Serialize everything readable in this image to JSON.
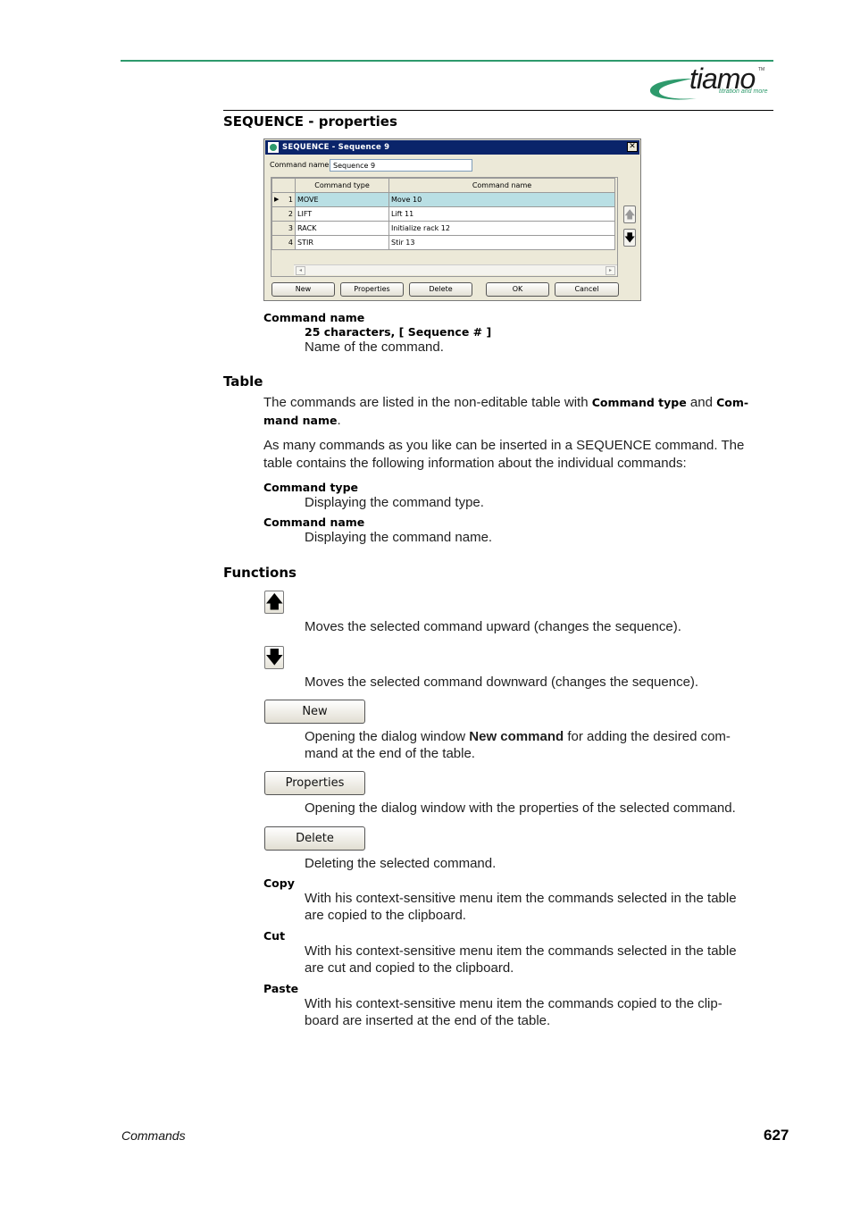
{
  "header": {
    "logo_text": "tiamo",
    "logo_tm": "TM",
    "logo_tagline": "titration and more",
    "brand_color": "#2e9a6c"
  },
  "page_title": "SEQUENCE - properties",
  "dialog": {
    "title": "SEQUENCE - Sequence 9",
    "close_glyph": "✕",
    "command_name_label": "Command name",
    "command_name_value": "Sequence 9",
    "columns": [
      "Command type",
      "Command name"
    ],
    "rows": [
      {
        "num": "1",
        "type": "MOVE",
        "name": "Move 10",
        "selected": true
      },
      {
        "num": "2",
        "type": "LIFT",
        "name": "Lift 11",
        "selected": false
      },
      {
        "num": "3",
        "type": "RACK",
        "name": "Initialize rack 12",
        "selected": false
      },
      {
        "num": "4",
        "type": "STIR",
        "name": "Stir 13",
        "selected": false
      }
    ],
    "row_pointer_glyph": "▶",
    "up_glyph": "🡅",
    "down_glyph": "🡇",
    "scroll_left_glyph": "◂",
    "scroll_right_glyph": "▸",
    "buttons": {
      "new": "New",
      "properties": "Properties",
      "delete": "Delete",
      "ok": "OK",
      "cancel": "Cancel"
    }
  },
  "command_name_param": {
    "label": "Command name",
    "spec": "25 characters, [ Sequence # ]",
    "desc": "Name of the command."
  },
  "table_section": {
    "title": "Table",
    "p1_a": "The commands are listed in the non-editable table with ",
    "p1_b": "Command type",
    "p1_c": " and ",
    "p1_d": "Com-",
    "p1_e": "mand name",
    "p1_f": ".",
    "p2_line1": "As many commands as you like can be inserted in a SEQUENCE command. The",
    "p2_line2": "table contains the following information about the individual commands:",
    "items": [
      {
        "label": "Command type",
        "desc": "Displaying the command type."
      },
      {
        "label": "Command name",
        "desc": "Displaying the command name."
      }
    ]
  },
  "functions_section": {
    "title": "Functions",
    "up_desc": "Moves the selected command upward (changes the sequence).",
    "down_desc": "Moves the selected command downward (changes the sequence).",
    "new_label": "New",
    "new_desc_a": "Opening the dialog window ",
    "new_desc_b": "New command",
    "new_desc_c": " for adding the desired com-",
    "new_desc_line2": "mand at the end of the table.",
    "properties_label": "Properties",
    "properties_desc": "Opening the dialog window with the properties of the selected command.",
    "delete_label": "Delete",
    "delete_desc": "Deleting the selected command.",
    "copy_label": "Copy",
    "copy_line1": "With his context-sensitive menu item the commands selected in the table",
    "copy_line2": "are copied to the clipboard.",
    "cut_label": "Cut",
    "cut_line1": "With his context-sensitive menu item the commands selected in the table",
    "cut_line2": "are cut and copied to the clipboard.",
    "paste_label": "Paste",
    "paste_line1": "With his context-sensitive menu item the commands copied to the clip-",
    "paste_line2": "board are inserted at the end of the table."
  },
  "footer": {
    "section": "Commands",
    "page_number": "627"
  }
}
